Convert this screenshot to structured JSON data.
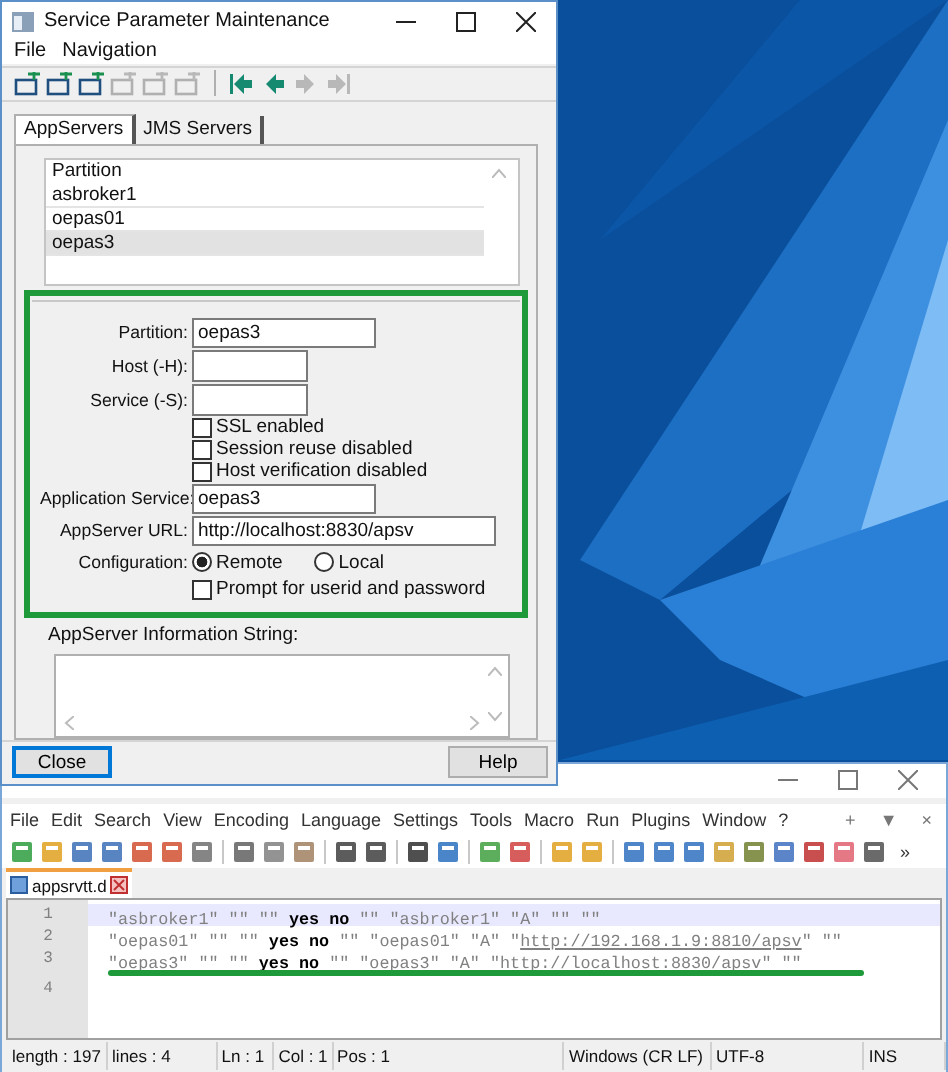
{
  "dialog": {
    "title": "Service Parameter Maintenance",
    "menu": [
      "File",
      "Navigation"
    ],
    "toolbar": [
      {
        "disabled": false
      },
      {
        "disabled": false
      },
      {
        "disabled": false
      },
      {
        "disabled": true
      },
      {
        "disabled": true
      },
      {
        "disabled": true
      }
    ],
    "nav_toolbar": [
      {
        "disabled": false
      },
      {
        "disabled": false
      },
      {
        "disabled": true
      },
      {
        "disabled": true
      }
    ],
    "tabs": [
      {
        "label": "AppServers",
        "selected": true
      },
      {
        "label": "JMS Servers",
        "selected": false
      }
    ],
    "list": {
      "column": "Partition",
      "rows": [
        {
          "text": "asbroker1",
          "selected": false
        },
        {
          "text": "oepas01",
          "selected": false
        },
        {
          "text": "oepas3",
          "selected": true
        }
      ]
    },
    "form": {
      "highlighted": true,
      "fields": [
        {
          "label": "Partition:",
          "value": "oepas3"
        },
        {
          "label": "Host (-H):"
        },
        {
          "label": "Service (-S):"
        }
      ],
      "options": [
        {
          "label": "SSL enabled",
          "checked": false
        },
        {
          "label": "Session reuse disabled",
          "checked": false
        },
        {
          "label": "Host verification disabled",
          "checked": false
        }
      ],
      "fields2": [
        {
          "label": "Application Service:",
          "value": "oepas3"
        },
        {
          "label": "AppServer URL:",
          "value": "http://localhost:8830/apsv"
        }
      ],
      "configuration": {
        "label": "Configuration:",
        "choices": [
          {
            "label": "Remote",
            "selected": true
          },
          {
            "label": "Local",
            "selected": false
          }
        ]
      },
      "prompt": {
        "label": "Prompt for userid and password",
        "checked": false
      }
    },
    "info": {
      "label": "AppServer Information String:"
    },
    "buttons": [
      {
        "label": "Close",
        "focused": true
      },
      {
        "label": "Help",
        "focused": false
      }
    ]
  },
  "editor": {
    "menu": [
      "File",
      "Edit",
      "Search",
      "View",
      "Encoding",
      "Language",
      "Settings",
      "Tools",
      "Macro",
      "Run",
      "Plugins",
      "Window",
      "?"
    ],
    "menu_right": [
      "+",
      "▼",
      "×"
    ],
    "overflow": "»",
    "tab": {
      "label": "appsrvtt.d"
    },
    "lines": [
      {
        "number": "1",
        "current": true,
        "underlined": false,
        "tokens": [
          {
            "kind": "string",
            "text": "\"asbroker1\" \"\" \"\" "
          },
          {
            "kind": "keyword",
            "text": "yes no"
          },
          {
            "kind": "string",
            "text": " \"\" \"asbroker1\" \"A\" \"\" \"\""
          }
        ]
      },
      {
        "number": "2",
        "current": false,
        "underlined": false,
        "tokens": [
          {
            "kind": "string",
            "text": "\"oepas01\" \"\" \"\" "
          },
          {
            "kind": "keyword",
            "text": "yes no"
          },
          {
            "kind": "string",
            "text": " \"\" \"oepas01\" \"A\" \""
          },
          {
            "kind": "url",
            "text": "http://192.168.1.9:8810/apsv"
          },
          {
            "kind": "string",
            "text": "\" \"\""
          }
        ]
      },
      {
        "number": "3",
        "current": false,
        "underlined": true,
        "tokens": [
          {
            "kind": "string",
            "text": "\"oepas3\" \"\" \"\" "
          },
          {
            "kind": "keyword",
            "text": "yes no"
          },
          {
            "kind": "string",
            "text": " \"\" \"oepas3\" \"A\" \""
          },
          {
            "kind": "url",
            "text": "http://localhost:8830/apsv"
          },
          {
            "kind": "string",
            "text": "\" \"\""
          }
        ]
      },
      {
        "number": "4",
        "current": false,
        "underlined": false
      }
    ],
    "status": [
      "length : 197",
      "lines : 4",
      "Ln : 1",
      "Col : 1",
      "Pos : 1",
      "Windows (CR LF)",
      "UTF-8",
      "INS"
    ]
  }
}
